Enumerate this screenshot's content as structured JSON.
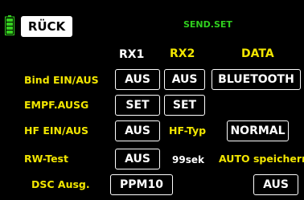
{
  "header": {
    "back_label": "RÜCK",
    "title": "SEND.SET",
    "battery_icon": "battery-icon"
  },
  "columns": {
    "rx1": "RX1",
    "rx2": "RX2",
    "data": "DATA"
  },
  "rows": {
    "bind": {
      "label": "Bind EIN/AUS",
      "rx1": "AUS",
      "rx2": "AUS",
      "data": "BLUETOOTH"
    },
    "empf": {
      "label": "EMPF.AUSG",
      "rx1": "SET",
      "rx2": "SET"
    },
    "hf": {
      "label": "HF EIN/AUS",
      "rx1": "AUS",
      "hf_typ_label": "HF-Typ",
      "hf_typ_value": "NORMAL"
    },
    "rw": {
      "label": "RW-Test",
      "rx1": "AUS",
      "time": "99sek",
      "auto_label": "AUTO speichern"
    },
    "dsc": {
      "label": "DSC Ausg.",
      "mode": "PPM10",
      "auto_value": "AUS"
    }
  },
  "colors": {
    "background": "#000000",
    "label_yellow": "#f2e600",
    "title_green": "#2fcf1e",
    "battery_green": "#35d01f",
    "text_white": "#ffffff"
  }
}
